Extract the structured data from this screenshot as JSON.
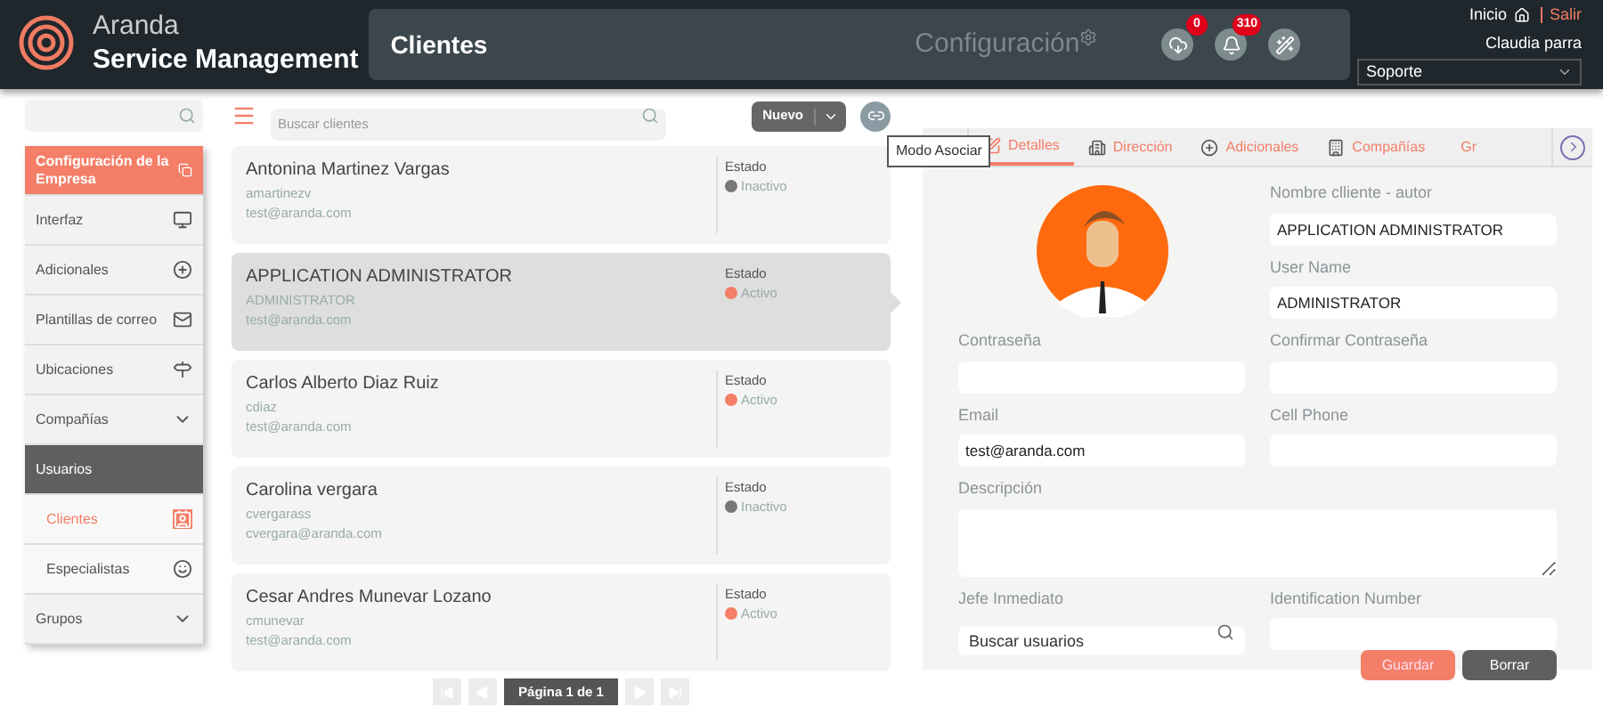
{
  "header": {
    "brand_top": "Aranda",
    "brand_bottom": "Service Management",
    "title": "Clientes",
    "section": "Configuración",
    "badges": [
      {
        "count": "0"
      },
      {
        "count": "310"
      }
    ],
    "home_link": "Inicio",
    "logout_link": "Salir",
    "user": "Claudia parra",
    "role": "Soporte"
  },
  "sidebar": {
    "items": [
      {
        "kind": "link",
        "label": "Configuración de la Empresa",
        "selected": true
      },
      {
        "kind": "link",
        "label": "Interfaz",
        "selected": false
      },
      {
        "kind": "link",
        "label": "Adicionales",
        "selected": false
      },
      {
        "kind": "link",
        "label": "Plantillas de correo",
        "selected": false
      },
      {
        "kind": "link",
        "label": "Ubicaciones",
        "selected": false
      },
      {
        "kind": "group",
        "label": "Compañías",
        "expanded": false
      },
      {
        "kind": "group",
        "label": "Usuarios",
        "expanded": true,
        "children": [
          {
            "label": "Clientes",
            "selected": true
          },
          {
            "label": "Especialistas",
            "selected": false
          }
        ]
      },
      {
        "kind": "group",
        "label": "Grupos",
        "expanded": false
      }
    ]
  },
  "toolbar": {
    "search_placeholder": "Buscar clientes",
    "new_button": "Nuevo",
    "tooltip": "Modo Asociar"
  },
  "clients": [
    {
      "name": "Antonina Martinez Vargas",
      "login": "amartinezv",
      "email": "test@aranda.com",
      "status_label": "Estado",
      "status": "Inactivo",
      "active": false,
      "selected": false
    },
    {
      "name": "APPLICATION ADMINISTRATOR",
      "login": "ADMINISTRATOR",
      "email": "test@aranda.com",
      "status_label": "Estado",
      "status": "Activo",
      "active": true,
      "selected": true
    },
    {
      "name": "Carlos Alberto Diaz Ruiz",
      "login": "cdiaz",
      "email": "test@aranda.com",
      "status_label": "Estado",
      "status": "Activo",
      "active": true,
      "selected": false
    },
    {
      "name": "Carolina vergara",
      "login": "cvergarass",
      "email": "cvergara@aranda.com",
      "status_label": "Estado",
      "status": "Inactivo",
      "active": false,
      "selected": false
    },
    {
      "name": "Cesar Andres Munevar Lozano",
      "login": "cmunevar",
      "email": "test@aranda.com",
      "status_label": "Estado",
      "status": "Activo",
      "active": true,
      "selected": false
    }
  ],
  "pagination": {
    "label": "Página 1 de 1"
  },
  "tabs": [
    {
      "label": "Detalles",
      "selected": true
    },
    {
      "label": "Dirección",
      "selected": false
    },
    {
      "label": "Adicionales",
      "selected": false
    },
    {
      "label": "Compañías",
      "selected": false
    },
    {
      "label": "Gr",
      "selected": false
    }
  ],
  "form": {
    "fields": [
      {
        "label": "Nombre clliente - autor",
        "value": "APPLICATION ADMINISTRATOR"
      },
      {
        "label": "User Name",
        "value": "ADMINISTRATOR"
      },
      {
        "label": "Contraseña"
      },
      {
        "label": "Confirmar Contraseña"
      },
      {
        "label": "Email",
        "value": "test@aranda.com"
      },
      {
        "label": "Cell Phone"
      },
      {
        "label": "Descripción"
      },
      {
        "label": "Jefe Inmediato",
        "placeholder": "Buscar usuarios"
      },
      {
        "label": "Identification Number"
      }
    ],
    "buttons": [
      {
        "label": "Guardar",
        "kind": "primary"
      },
      {
        "label": "Borrar",
        "kind": "secondary"
      }
    ]
  }
}
